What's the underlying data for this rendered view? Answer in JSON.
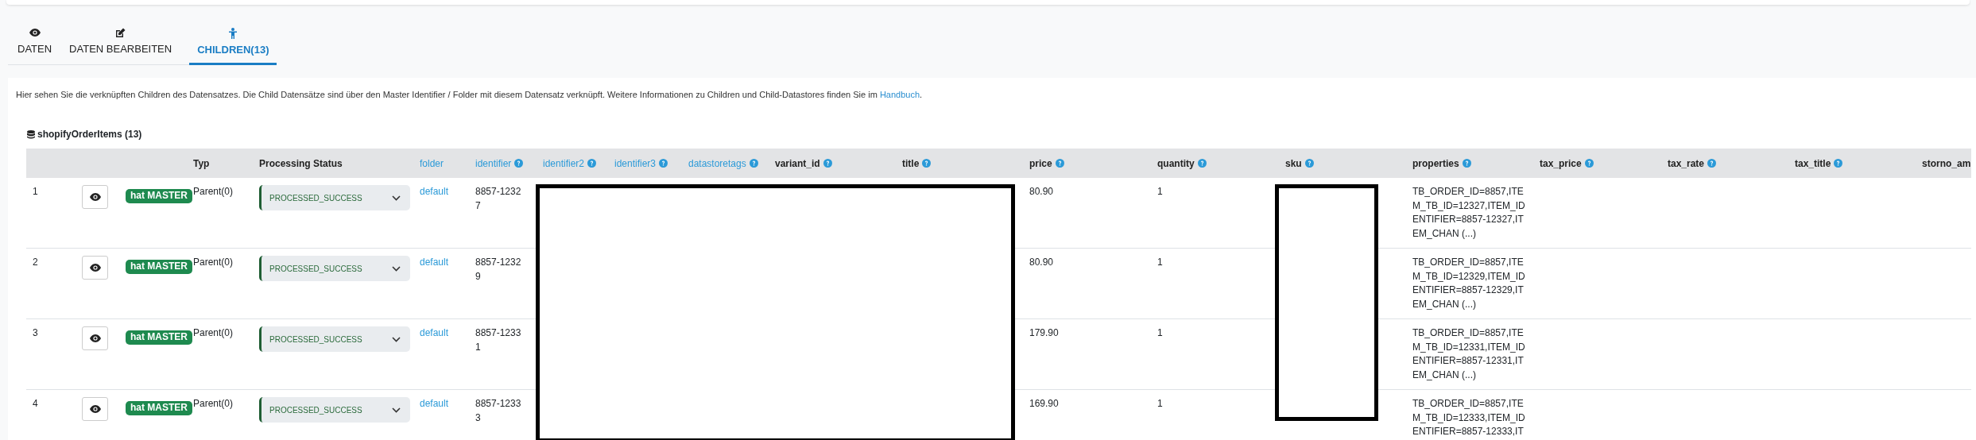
{
  "tabs": [
    {
      "label": "DATEN",
      "selected": false
    },
    {
      "label": "DATEN BEARBEITEN",
      "selected": false
    },
    {
      "label": "CHILDREN(13)",
      "selected": true
    }
  ],
  "description": {
    "text": "Hier sehen Sie die verknüpften Children des Datensatzes. Die Child Datensätze sind über den Master Identifier / Folder mit diesem Datensatz verknüpft. Weitere Informationen zu Children und Child-Datastores finden Sie im ",
    "link": "Handbuch",
    "after": "."
  },
  "table": {
    "title": "shopifyOrderItems (13)",
    "columns": [
      {
        "label": "Typ",
        "kind": "plain",
        "help": false
      },
      {
        "label": "Processing Status",
        "kind": "plain",
        "help": false
      },
      {
        "label": "folder",
        "kind": "link",
        "help": false
      },
      {
        "label": "identifier",
        "kind": "link",
        "help": true
      },
      {
        "label": "identifier2",
        "kind": "link",
        "help": true
      },
      {
        "label": "identifier3",
        "kind": "link",
        "help": true
      },
      {
        "label": "datastoretags",
        "kind": "link",
        "help": true
      },
      {
        "label": "variant_id",
        "kind": "plain",
        "help": true
      },
      {
        "label": "title",
        "kind": "plain",
        "help": true
      },
      {
        "label": "price",
        "kind": "plain",
        "help": true
      },
      {
        "label": "quantity",
        "kind": "plain",
        "help": true
      },
      {
        "label": "sku",
        "kind": "plain",
        "help": true
      },
      {
        "label": "properties",
        "kind": "plain",
        "help": true
      },
      {
        "label": "tax_price",
        "kind": "plain",
        "help": true
      },
      {
        "label": "tax_rate",
        "kind": "plain",
        "help": true
      },
      {
        "label": "tax_title",
        "kind": "plain",
        "help": true
      },
      {
        "label": "storno_am",
        "kind": "plain"
      }
    ],
    "rows": [
      {
        "number": "1",
        "badge": "hat MASTER",
        "typ": "Parent(0)",
        "status": "PROCESSED_SUCCESS",
        "folder": "default",
        "identifier": "8857-12327",
        "price": "80.90",
        "quantity": "1",
        "properties": "TB_ORDER_ID=8857,ITEM_TB_ID=12327,ITEM_IDENTIFIER=8857-12327,ITEM_CHAN (...)"
      },
      {
        "number": "2",
        "badge": "hat MASTER",
        "typ": "Parent(0)",
        "status": "PROCESSED_SUCCESS",
        "folder": "default",
        "identifier": "8857-12329",
        "price": "80.90",
        "quantity": "1",
        "properties": "TB_ORDER_ID=8857,ITEM_TB_ID=12329,ITEM_IDENTIFIER=8857-12329,ITEM_CHAN (...)"
      },
      {
        "number": "3",
        "badge": "hat MASTER",
        "typ": "Parent(0)",
        "status": "PROCESSED_SUCCESS",
        "folder": "default",
        "identifier": "8857-12331",
        "price": "179.90",
        "quantity": "1",
        "properties": "TB_ORDER_ID=8857,ITEM_TB_ID=12331,ITEM_IDENTIFIER=8857-12331,ITEM_CHAN (...)"
      },
      {
        "number": "4",
        "badge": "hat MASTER",
        "typ": "Parent(0)",
        "status": "PROCESSED_SUCCESS",
        "folder": "default",
        "identifier": "8857-12333",
        "price": "169.90",
        "quantity": "1",
        "properties": "TB_ORDER_ID=8857,ITEM_TB_ID=12333,ITEM_IDENTIFIER=8857-12333,IT"
      }
    ]
  }
}
